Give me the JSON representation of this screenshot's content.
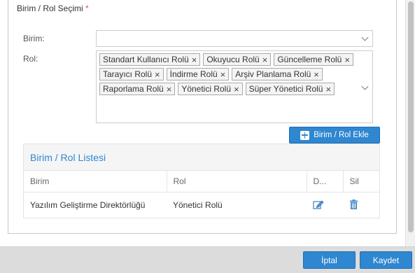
{
  "section": {
    "title": "Birim / Rol Seçimi",
    "required_mark": "*"
  },
  "form": {
    "birim_label": "Birim:",
    "birim_value": "",
    "rol_label": "Rol:",
    "roles": [
      "Standart Kullanıcı Rolü",
      "Okuyucu Rolü",
      "Güncelleme Rolü",
      "Tarayıcı Rolü",
      "İndirme Rolü",
      "Arşiv Planlama Rolü",
      "Raporlama Rolü",
      "Yönetici Rolü",
      "Süper Yönetici Rolü"
    ],
    "chip_remove_glyph": "×"
  },
  "add_button": {
    "label": "Birim / Rol Ekle",
    "icon": "plus-square-icon"
  },
  "list": {
    "title": "Birim / Rol Listesi",
    "columns": [
      "Birim",
      "Rol",
      "D...",
      "Sil"
    ],
    "rows": [
      {
        "birim": "Yazılım Geliştirme Direktörlüğü",
        "rol": "Yönetici Rolü",
        "edit_icon": "edit-icon",
        "delete_icon": "trash-icon"
      }
    ]
  },
  "footer": {
    "cancel_label": "İptal",
    "save_label": "Kaydet"
  },
  "colors": {
    "accent": "#2f86d1",
    "required": "#d9534f",
    "footer_bg": "#dcdcdc"
  }
}
